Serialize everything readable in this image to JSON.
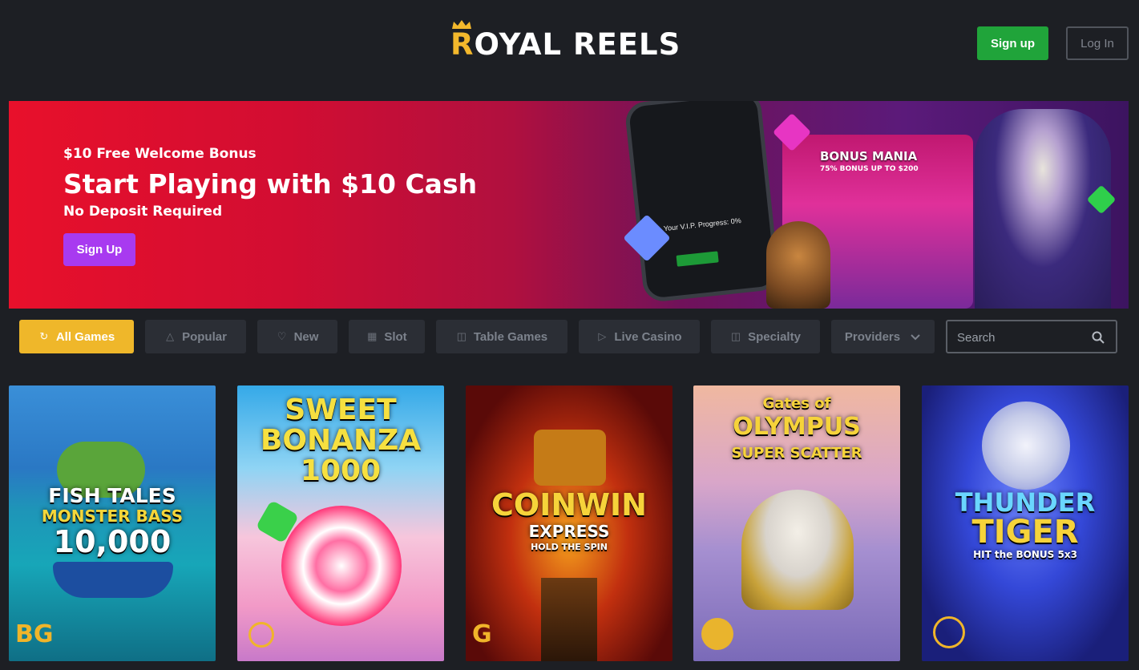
{
  "header": {
    "logo_first": "R",
    "logo_rest": "OYAL REELS",
    "signup_label": "Sign up",
    "login_label": "Log In"
  },
  "banner": {
    "subtitle": "$10 Free Welcome Bonus",
    "title": "Start Playing with $10 Cash",
    "note": "No Deposit Required",
    "button_label": "Sign Up",
    "phone_text": "Your V.I.P. Progress: 0%",
    "promo_title": "BONUS MANIA",
    "promo_sub": "75% BONUS UP TO $200"
  },
  "filters": {
    "items": [
      {
        "label": "All Games",
        "icon": "all-games-icon"
      },
      {
        "label": "Popular",
        "icon": "flame-icon"
      },
      {
        "label": "New",
        "icon": "bell-icon"
      },
      {
        "label": "Slot",
        "icon": "slot-machine-icon"
      },
      {
        "label": "Table Games",
        "icon": "cards-icon"
      },
      {
        "label": "Live Casino",
        "icon": "video-icon"
      },
      {
        "label": "Specialty",
        "icon": "cards-icon"
      },
      {
        "label": "Providers",
        "icon": "chevron-down-icon"
      }
    ],
    "search_placeholder": "Search"
  },
  "games": [
    {
      "title_line1": "FISH TALES",
      "title_line2": "MONSTER BASS",
      "title_line3": "10,000",
      "provider": "BG"
    },
    {
      "title_line1": "SWEET",
      "title_line2": "BONANZA",
      "title_line3": "1000",
      "provider": ""
    },
    {
      "title_line1": "COINWIN",
      "title_line2": "EXPRESS",
      "title_line3": "HOLD THE SPIN",
      "provider": "G"
    },
    {
      "title_line1": "Gates of",
      "title_line2": "OLYMPUS",
      "title_line3": "SUPER SCATTER",
      "provider": ""
    },
    {
      "title_line1": "THUNDER",
      "title_line2": "TIGER",
      "title_line3": "HIT the BONUS 5x3",
      "provider": ""
    }
  ],
  "colors": {
    "background": "#1d1f24",
    "accent_gold": "#efb72a",
    "signup_green": "#20a43a",
    "banner_purple_button": "#a83af0"
  }
}
